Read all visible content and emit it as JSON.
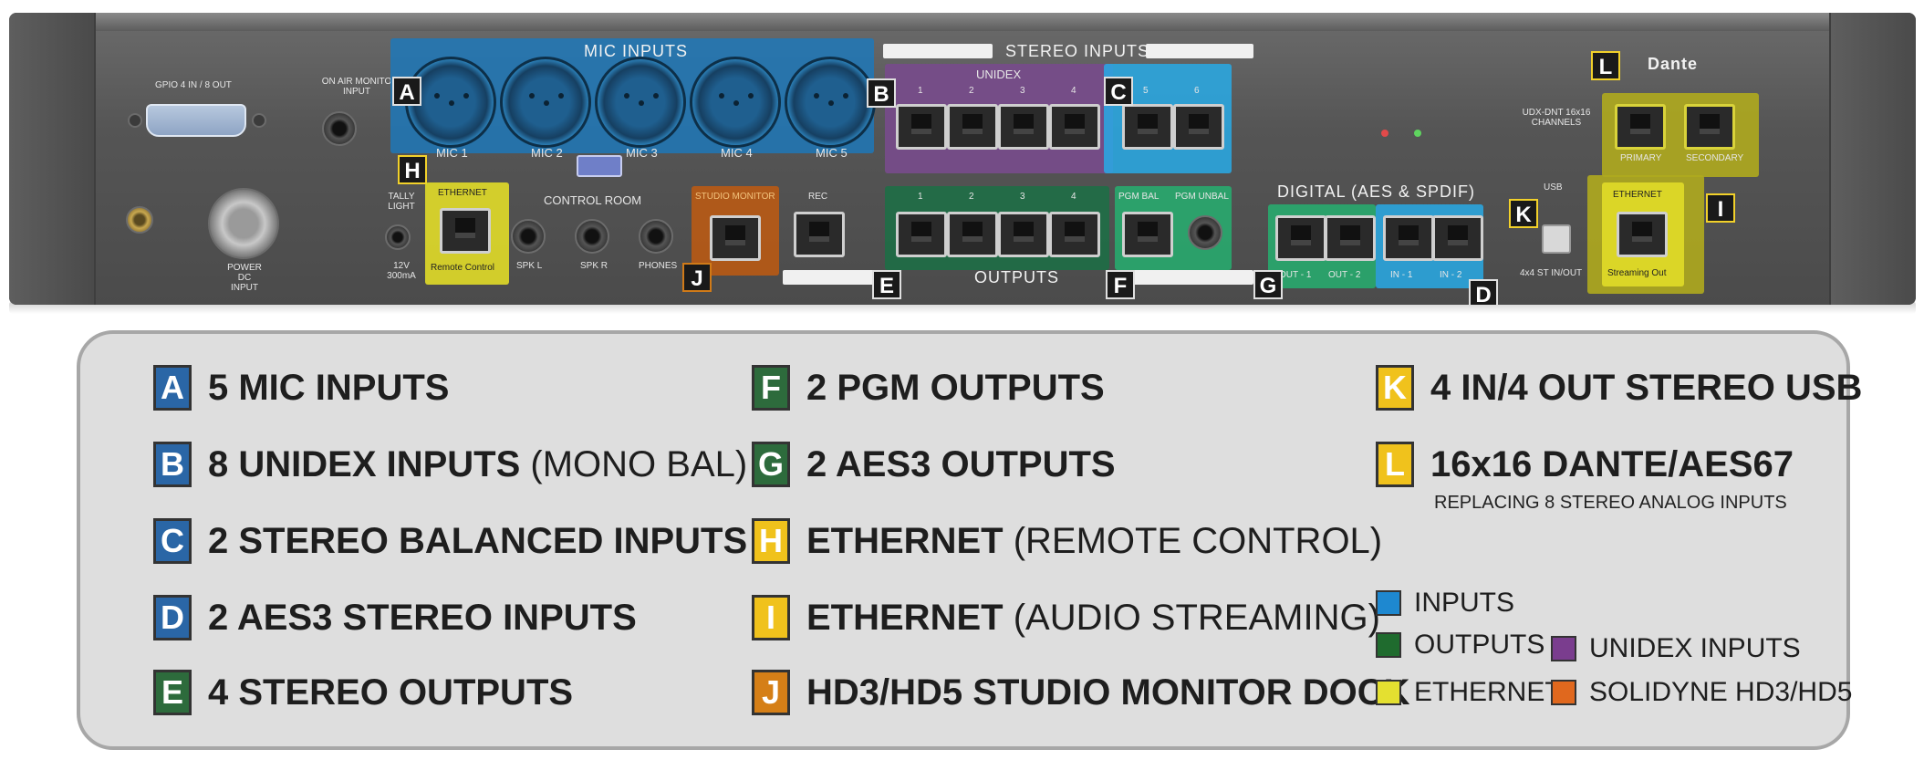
{
  "panel": {
    "gpio_label": "GPIO 4 IN / 8 OUT",
    "on_air_label": "ON AIR MONITO INPUT",
    "mic_inputs_title": "MIC INPUTS",
    "mic_labels": [
      "MIC 1",
      "MIC 2",
      "MIC 3",
      "MIC 4",
      "MIC 5"
    ],
    "stereo_inputs_title": "STEREO INPUTS",
    "unidex_label": "UNIDEX",
    "unidex_numbers": [
      "1",
      "2",
      "3",
      "4"
    ],
    "stereo_numbers": [
      "5",
      "6"
    ],
    "dante_logo": "Dante",
    "udx_label": "UDX-DNT 16x16 CHANNELS",
    "primary_label": "PRIMARY",
    "secondary_label": "SECONDARY",
    "tally_label": "TALLY LIGHT",
    "tally_power": "12V 300mA",
    "ethernet_label": "ETHERNET",
    "remote_control_label": "Remote Control",
    "control_room_label": "CONTROL ROOM",
    "spk_l": "SPK L",
    "spk_r": "SPK R",
    "phones": "PHONES",
    "studio_monitor_label": "STUDIO MONITOR",
    "rec_label": "REC",
    "output_numbers": [
      "1",
      "2",
      "3",
      "4"
    ],
    "pgm_bal": "PGM BAL",
    "pgm_unbal": "PGM UNBAL",
    "digital_label": "DIGITAL (AES & SPDIF)",
    "out_1": "OUT - 1",
    "out_2": "OUT - 2",
    "in_1": "IN - 1",
    "in_2": "IN - 2",
    "usb_label": "USB",
    "usb_sub": "4x4 ST IN/OUT",
    "streaming_label": "ETHERNET",
    "streaming_out": "Streaming Out",
    "outputs_title": "OUTPUTS",
    "power_label": "POWER DC INPUT",
    "callouts": [
      "A",
      "B",
      "C",
      "D",
      "E",
      "F",
      "G",
      "H",
      "I",
      "J",
      "K",
      "L"
    ]
  },
  "legend": {
    "items": [
      {
        "letter": "A",
        "bold": "5 MIC INPUTS",
        "light": ""
      },
      {
        "letter": "B",
        "bold": "8 UNIDEX INPUTS",
        "light": " (MONO BAL)"
      },
      {
        "letter": "C",
        "bold": "2 STEREO BALANCED INPUTS",
        "light": ""
      },
      {
        "letter": "D",
        "bold": "2 AES3 STEREO INPUTS",
        "light": ""
      },
      {
        "letter": "E",
        "bold": "4 STEREO OUTPUTS",
        "light": ""
      },
      {
        "letter": "F",
        "bold": "2 PGM OUTPUTS",
        "light": ""
      },
      {
        "letter": "G",
        "bold": "2 AES3 OUTPUTS",
        "light": ""
      },
      {
        "letter": "H",
        "bold": "ETHERNET",
        "light": " (REMOTE CONTROL)"
      },
      {
        "letter": "I",
        "bold": "ETHERNET",
        "light": " (AUDIO STREAMING)"
      },
      {
        "letter": "J",
        "bold": "HD3/HD5 STUDIO MONITOR DOCK",
        "light": ""
      },
      {
        "letter": "K",
        "bold": "4 IN/4 OUT STEREO USB",
        "light": ""
      },
      {
        "letter": "L",
        "bold": "16x16 DANTE/AES67",
        "light": ""
      }
    ],
    "l_note": "REPLACING 8 STEREO ANALOG INPUTS",
    "swatches": [
      {
        "label": "INPUTS",
        "color": "#1e88d0"
      },
      {
        "label": "OUTPUTS",
        "color": "#1f6b2e"
      },
      {
        "label": "UNIDEX INPUTS",
        "color": "#7a3d8e"
      },
      {
        "label": "ETHERNET",
        "color": "#e4e030"
      },
      {
        "label": "SOLIDYNE HD3/HD5",
        "color": "#e0681e"
      }
    ]
  }
}
